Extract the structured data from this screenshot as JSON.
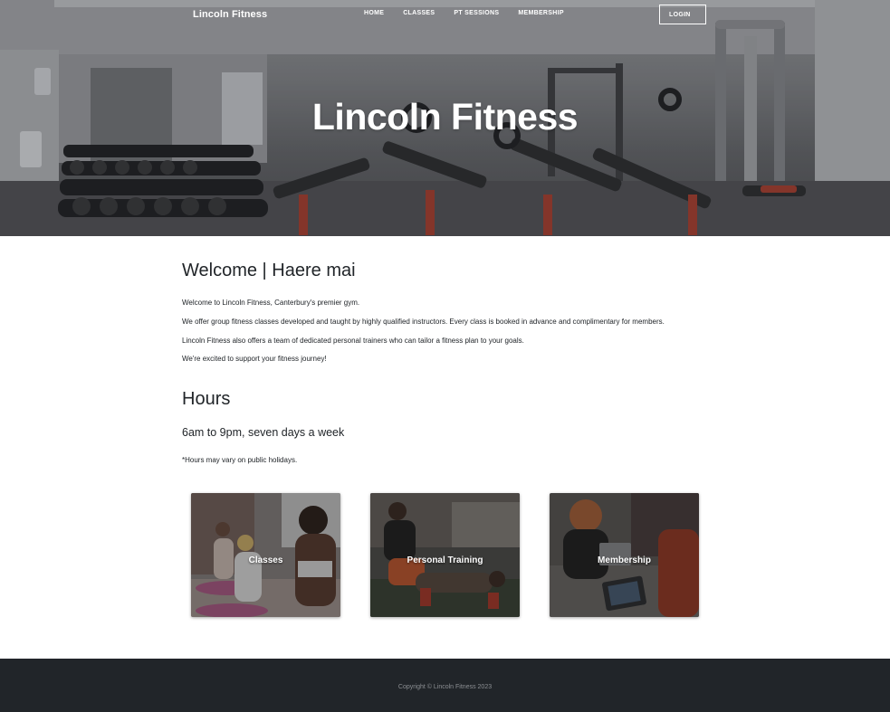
{
  "nav": {
    "brand": "Lincoln Fitness",
    "links": [
      "HOME",
      "CLASSES",
      "PT SESSIONS",
      "MEMBERSHIP"
    ],
    "login": "LOGIN"
  },
  "hero": {
    "title": "Lincoln Fitness"
  },
  "welcome": {
    "heading": "Welcome | Haere mai",
    "paragraphs": [
      "Welcome to Lincoln Fitness, Canterbury's premier gym.",
      "We offer group fitness classes developed and taught by highly qualified instructors. Every class is booked in advance and complimentary for members.",
      "Lincoln Fitness also offers a team of dedicated personal trainers who can tailor a fitness plan to your goals.",
      "We're excited to support your fitness journey!"
    ]
  },
  "hours": {
    "heading": "Hours",
    "subheading": "6am to 9pm, seven days a week",
    "note": "*Hours may vary on public holidays."
  },
  "cards": [
    {
      "label": "Classes"
    },
    {
      "label": "Personal Training"
    },
    {
      "label": "Membership"
    }
  ],
  "footer": {
    "copyright": "Copyright © Lincoln Fitness 2023"
  },
  "colors": {
    "footer_bg": "#212529",
    "text": "#212529",
    "white": "#ffffff"
  }
}
